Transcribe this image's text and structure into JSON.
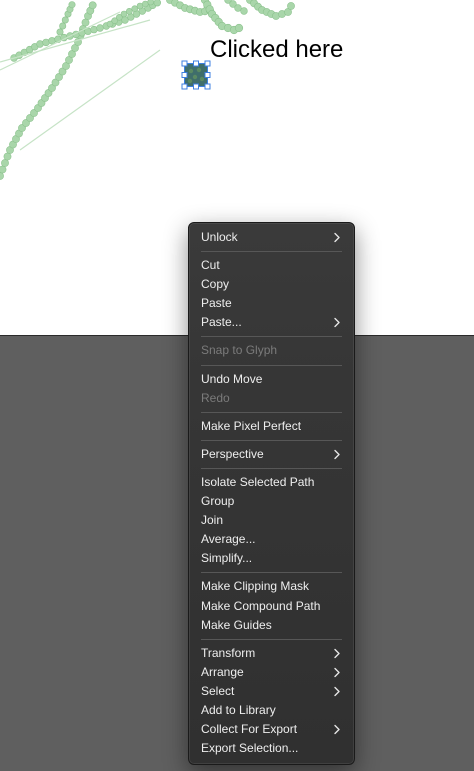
{
  "annotation": "Clicked here",
  "colors": {
    "artboard": "#ffffff",
    "pasteboard": "#5f5f5f",
    "menu_bg": "#333333",
    "menu_text": "#eeeeee",
    "menu_text_disabled": "#7b7b7b",
    "selection_blue": "#3d7fe0",
    "selected_fill": "#3f6e6b",
    "bead_green": "#a9d6aa"
  },
  "context_menu": {
    "groups": [
      [
        {
          "label": "Unlock",
          "submenu": true,
          "disabled": false
        }
      ],
      [
        {
          "label": "Cut",
          "submenu": false,
          "disabled": false
        },
        {
          "label": "Copy",
          "submenu": false,
          "disabled": false
        },
        {
          "label": "Paste",
          "submenu": false,
          "disabled": false
        },
        {
          "label": "Paste...",
          "submenu": true,
          "disabled": false
        }
      ],
      [
        {
          "label": "Snap to Glyph",
          "submenu": false,
          "disabled": true
        }
      ],
      [
        {
          "label": "Undo Move",
          "submenu": false,
          "disabled": false
        },
        {
          "label": "Redo",
          "submenu": false,
          "disabled": true
        }
      ],
      [
        {
          "label": "Make Pixel Perfect",
          "submenu": false,
          "disabled": false
        }
      ],
      [
        {
          "label": "Perspective",
          "submenu": true,
          "disabled": false
        }
      ],
      [
        {
          "label": "Isolate Selected Path",
          "submenu": false,
          "disabled": false
        },
        {
          "label": "Group",
          "submenu": false,
          "disabled": false
        },
        {
          "label": "Join",
          "submenu": false,
          "disabled": false
        },
        {
          "label": "Average...",
          "submenu": false,
          "disabled": false
        },
        {
          "label": "Simplify...",
          "submenu": false,
          "disabled": false
        }
      ],
      [
        {
          "label": "Make Clipping Mask",
          "submenu": false,
          "disabled": false
        },
        {
          "label": "Make Compound Path",
          "submenu": false,
          "disabled": false
        },
        {
          "label": "Make Guides",
          "submenu": false,
          "disabled": false
        }
      ],
      [
        {
          "label": "Transform",
          "submenu": true,
          "disabled": false
        },
        {
          "label": "Arrange",
          "submenu": true,
          "disabled": false
        },
        {
          "label": "Select",
          "submenu": true,
          "disabled": false
        },
        {
          "label": "Add to Library",
          "submenu": false,
          "disabled": false
        },
        {
          "label": "Collect For Export",
          "submenu": true,
          "disabled": false
        },
        {
          "label": "Export Selection...",
          "submenu": false,
          "disabled": false
        }
      ]
    ]
  }
}
